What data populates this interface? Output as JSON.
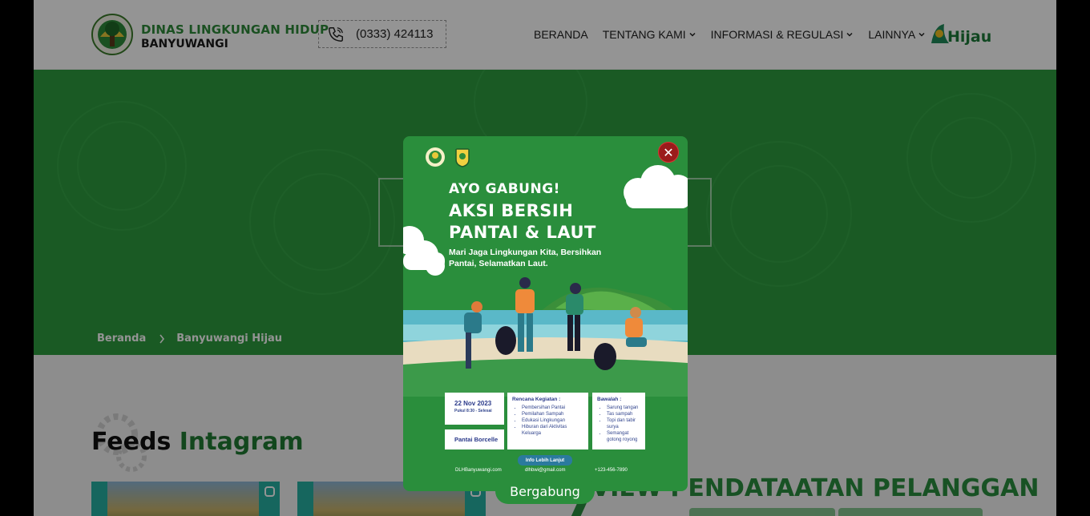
{
  "header": {
    "brand_line1": "DINAS LINGKUNGAN HIDUP",
    "brand_line2": "BANYUWANGI",
    "phone": "(0333) 424113",
    "nav": [
      {
        "label": "BERANDA",
        "has_dropdown": false
      },
      {
        "label": "TENTANG KAMI",
        "has_dropdown": true
      },
      {
        "label": "INFORMASI & REGULASI",
        "has_dropdown": true
      },
      {
        "label": "LAINNYA",
        "has_dropdown": true
      }
    ],
    "partner_logo_text": "Hijau"
  },
  "hero": {
    "breadcrumb": [
      "Beranda",
      "Banyuwangi Hijau"
    ]
  },
  "feeds": {
    "title_a": "Feeds",
    "title_b": "Intagram"
  },
  "survey": {
    "title": "VIEW PENDATAATAN PELANGGAN"
  },
  "modal": {
    "headline_small": "AYO GABUNG!",
    "headline_big": "AKSI BERSIH PANTAI & LAUT",
    "subtitle": "Mari Jaga Lingkungan Kita, Bersihkan Pantai, Selamatkan Laut.",
    "date": "22 Nov 2023",
    "time": "Pukul 8:30 - Selesai",
    "place": "Pantai Borcelle",
    "plan_title": "Rencana Kegiatan :",
    "plan_items": [
      "Pembersihan Pantai",
      "Pemilahan Sampah",
      "Edukasi Lingkungan",
      "Hiburan dari Aktivitas Keluarga"
    ],
    "bring_title": "Bawalah :",
    "bring_items": [
      "Sarung tangan",
      "Tas sampah",
      "Topi dan tabir surya",
      "Semangat gotong royong"
    ],
    "info_button": "Info Lebih Lanjut",
    "footer_left": "DLHBanyuwangi.com",
    "footer_mid": "dlhbwi@gmail.com",
    "footer_right": "+123-456-7890",
    "close_symbol": "✕",
    "join_button": "Bergabung"
  },
  "colors": {
    "primary_green": "#2e9b3f",
    "dark_green": "#1f7a33",
    "close_red": "#9b1b1b"
  }
}
